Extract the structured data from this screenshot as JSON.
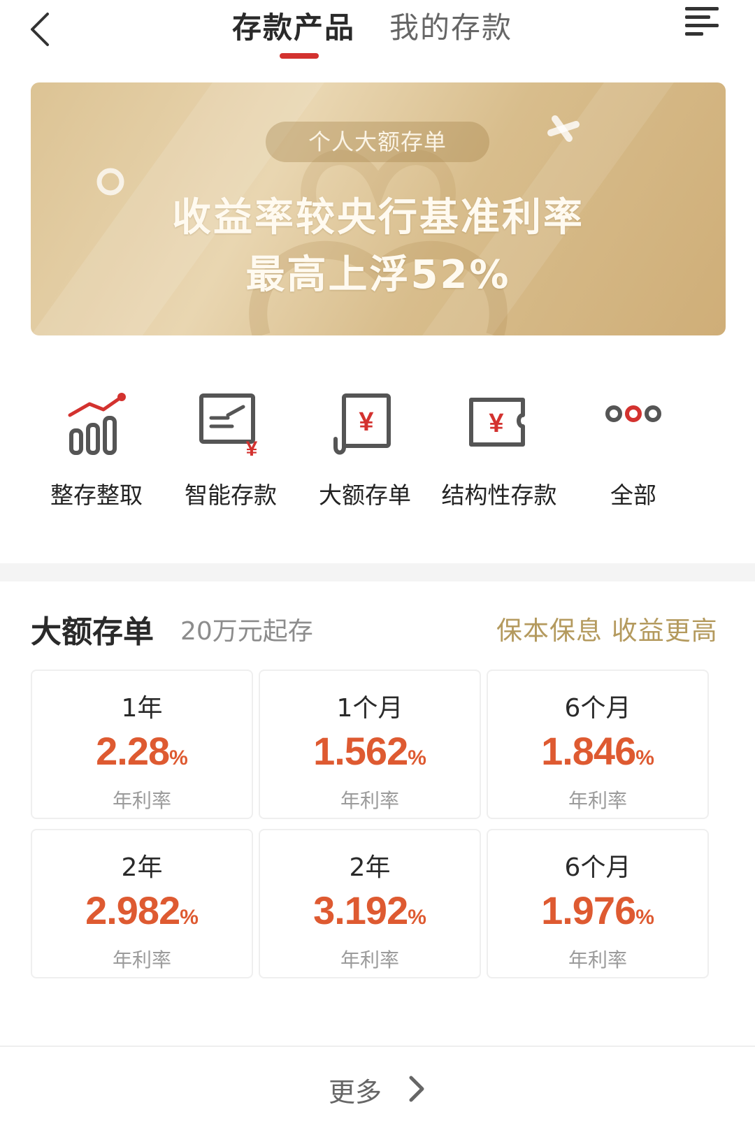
{
  "header": {
    "tabs": [
      {
        "label": "存款产品",
        "active": true
      },
      {
        "label": "我的存款",
        "active": false
      }
    ],
    "back_icon": "chevron-left-icon",
    "menu_icon": "menu-icon"
  },
  "banner": {
    "pill": "个人大额存单",
    "line1": "收益率较央行基准利率",
    "line2": "最高上浮52%"
  },
  "categories": [
    {
      "label": "整存整取",
      "icon": "bar-growth-icon"
    },
    {
      "label": "智能存款",
      "icon": "smart-deposit-icon"
    },
    {
      "label": "大额存单",
      "icon": "certificate-yuan-icon"
    },
    {
      "label": "结构性存款",
      "icon": "ticket-yuan-icon"
    },
    {
      "label": "全部",
      "icon": "more-dots-icon"
    }
  ],
  "section": {
    "title": "大额存单",
    "subtitle": "20万元起存",
    "slogan": "保本保息 收益更高"
  },
  "rates": [
    {
      "term": "1年",
      "rate": "2.28",
      "unit": "%",
      "label": "年利率"
    },
    {
      "term": "1个月",
      "rate": "1.562",
      "unit": "%",
      "label": "年利率"
    },
    {
      "term": "6个月",
      "rate": "1.846",
      "unit": "%",
      "label": "年利率"
    },
    {
      "term": "2年",
      "rate": "2.982",
      "unit": "%",
      "label": "年利率"
    },
    {
      "term": "2年",
      "rate": "3.192",
      "unit": "%",
      "label": "年利率"
    },
    {
      "term": "6个月",
      "rate": "1.976",
      "unit": "%",
      "label": "年利率"
    }
  ],
  "more": {
    "label": "更多"
  },
  "colors": {
    "accent": "#d3322f",
    "rate": "#de5a31",
    "gold": "#b49a5e"
  }
}
